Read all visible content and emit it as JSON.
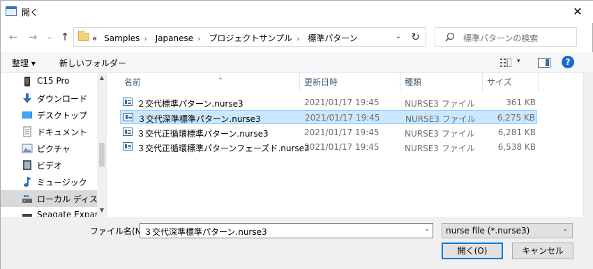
{
  "window": {
    "title": "開く",
    "close_glyph": "✕"
  },
  "nav": {
    "back_glyph": "←",
    "forward_glyph": "→",
    "recent_glyph": "⌄",
    "up_glyph": "↑",
    "breadcrumb_overflow": "«",
    "breadcrumb": [
      "Samples",
      "Japanese",
      "プロジェクトサンプル",
      "標準パターン"
    ],
    "breadcrumb_sep": "›",
    "address_dropdown_glyph": "⌄",
    "refresh_glyph": "↻",
    "search_placeholder": "標準パターンの検索"
  },
  "toolbar": {
    "organize_label": "整理 ▾",
    "new_folder_label": "新しいフォルダー",
    "view_dropdown_glyph": "▾",
    "help_label": "?"
  },
  "sidebar": {
    "items": [
      {
        "label": "C15 Pro",
        "icon": "phone-icon"
      },
      {
        "label": "ダウンロード",
        "icon": "download-icon"
      },
      {
        "label": "デスクトップ",
        "icon": "desktop-icon"
      },
      {
        "label": "ドキュメント",
        "icon": "documents-icon"
      },
      {
        "label": "ピクチャ",
        "icon": "pictures-icon"
      },
      {
        "label": "ビデオ",
        "icon": "videos-icon"
      },
      {
        "label": "ミュージック",
        "icon": "music-icon"
      },
      {
        "label": "ローカル ディスク (C",
        "icon": "disk-icon",
        "selected": true
      },
      {
        "label": "Seagate Expansi",
        "icon": "external-drive-icon"
      }
    ],
    "scroll_up_glyph": "▲",
    "scroll_down_glyph": "▼"
  },
  "columns": {
    "name": "名前",
    "modified": "更新日時",
    "type": "種類",
    "size": "サイズ",
    "sort_glyph": "^"
  },
  "files": [
    {
      "name": "２交代標準パターン.nurse3",
      "modified": "2021/01/17 19:45",
      "type": "NURSE3 ファイル",
      "size": "361 KB"
    },
    {
      "name": "３交代深準標準パターン.nurse3",
      "modified": "2021/01/17 19:45",
      "type": "NURSE3 ファイル",
      "size": "6,275 KB",
      "selected": true
    },
    {
      "name": "３交代正循環標準パターン.nurse3",
      "modified": "2021/01/17 19:45",
      "type": "NURSE3 ファイル",
      "size": "6,281 KB"
    },
    {
      "name": "３交代正循環標準パターンフェーズド.nurse3",
      "modified": "2021/01/17 19:45",
      "type": "NURSE3 ファイル",
      "size": "6,538 KB"
    }
  ],
  "bottom": {
    "filename_label": "ファイル名(N):",
    "filename_value": "３交代深準標準パターン.nurse3",
    "filename_dropdown_glyph": "⌄",
    "filetype_value": "nurse file (*.nurse3)",
    "filetype_dropdown_glyph": "⌄",
    "open_label": "開く(O)",
    "cancel_label": "キャンセル"
  }
}
